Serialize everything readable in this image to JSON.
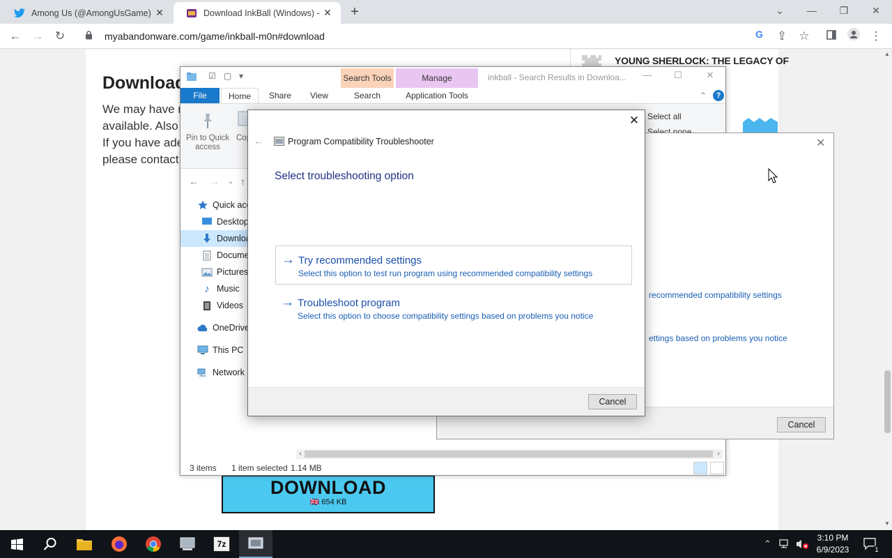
{
  "browser": {
    "tabs": [
      {
        "title": "Among Us (@AmongUsGame) /",
        "active": false
      },
      {
        "title": "Download InkBall (Windows) - M",
        "active": true
      }
    ],
    "new_tab": "+",
    "window_controls": {
      "dropdown": "⌄",
      "minimize": "—",
      "restore": "❐",
      "close": "✕"
    },
    "url": "myabandonware.com/game/inkball-m0n#download"
  },
  "page": {
    "heading": "Download I",
    "paragraph_lines": [
      "We may have r",
      "available. Also",
      "If you have ade",
      "please contact"
    ],
    "sidebar_title": "YOUNG SHERLOCK: THE LEGACY OF",
    "download_button": {
      "label": "DOWNLOAD",
      "size": "🇬🇧 654 KB"
    }
  },
  "explorer": {
    "title": "inkball - Search Results in Downloa...",
    "context_tabs": {
      "search_tools": "Search Tools",
      "manage": "Manage"
    },
    "ribbon_tabs": [
      "File",
      "Home",
      "Share",
      "View",
      "Search",
      "Application Tools"
    ],
    "ribbon": {
      "pin_label": "Pin to Quick access",
      "copy_label": "Cop",
      "select_all": "Select all",
      "select_none": "Select none"
    },
    "tree": [
      {
        "label": "Quick acce",
        "icon": "star-icon"
      },
      {
        "label": "Desktop",
        "icon": "desktop-icon"
      },
      {
        "label": "Downloa",
        "icon": "download-arrow-icon",
        "selected": true
      },
      {
        "label": "Docume",
        "icon": "document-icon"
      },
      {
        "label": "Pictures",
        "icon": "pictures-icon"
      },
      {
        "label": "Music",
        "icon": "music-icon"
      },
      {
        "label": "Videos",
        "icon": "video-icon"
      },
      {
        "label": "OneDrive",
        "icon": "cloud-icon"
      },
      {
        "label": "This PC",
        "icon": "computer-icon"
      },
      {
        "label": "Network",
        "icon": "network-icon"
      }
    ],
    "status": {
      "items": "3 items",
      "selected": "1 item selected",
      "size": "1.14 MB"
    }
  },
  "bg_dialog": {
    "link1_desc": "recommended compatibility settings",
    "link2_desc": "ettings based on problems you notice",
    "cancel": "Cancel"
  },
  "dialog": {
    "app_title": "Program Compatibility Troubleshooter",
    "heading": "Select troubleshooting option",
    "options": [
      {
        "title": "Try recommended settings",
        "desc": "Select this option to test run program using recommended compatibility settings"
      },
      {
        "title": "Troubleshoot program",
        "desc": "Select this option to choose compatibility settings based on problems you notice"
      }
    ],
    "cancel": "Cancel",
    "close": "✕"
  },
  "taskbar": {
    "time": "3:10 PM",
    "date": "6/9/2023",
    "notification_count": "1",
    "app_7zip_label": "7z"
  },
  "colors": {
    "accent": "#1a5fb4",
    "heading": "#1e3287",
    "explorer_file_tab": "#1979ca"
  }
}
